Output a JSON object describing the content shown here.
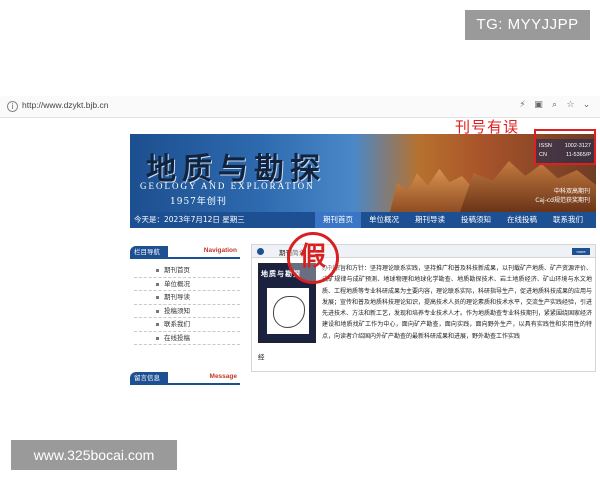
{
  "watermarks": {
    "top": "TG: MYYJJPP",
    "bottom": "www.325bocai.com"
  },
  "browser": {
    "url": "http://www.dzykt.bjb.cn",
    "icons": [
      "bolt-icon",
      "cube-icon",
      "zoom-icon",
      "star-icon",
      "chevron-down-icon"
    ]
  },
  "annotation": {
    "label": "刊号有误",
    "color": "#e02020"
  },
  "banner": {
    "title_cn": "地质与勘探",
    "title_en": "GEOLOGY AND EXPLORATION",
    "founded": "1957年创刊",
    "issn_label": "ISSN",
    "issn_value": "1002-3127",
    "cn_label": "CN",
    "cn_value": "11-5365/P",
    "core_line1": "中科双高期刊",
    "core_line2": "Caj-cd规范获奖期刊"
  },
  "navbar": {
    "date": "今天是：2023年7月12日 星期三",
    "items": [
      "期刊首页",
      "单位概况",
      "期刊导读",
      "投稿须知",
      "在线投稿",
      "联系我们"
    ],
    "active_index": 0
  },
  "sidebar": {
    "nav_title": "栏目导航",
    "nav_title_en": "Navigation",
    "items": [
      "期刊首页",
      "单位概况",
      "期刊导读",
      "投稿须知",
      "联系我们",
      "在线投稿"
    ],
    "message_title": "留言信息",
    "message_title_en": "Message"
  },
  "main": {
    "section_title": "期刊简介",
    "more_label": "more",
    "cover_title": "地质与勘探",
    "intro": "办刊宗旨和方针：坚持理论联系实践，坚持推广和普及科技新成果，以刊载矿产地质、矿产资源评价、成矿规律与成矿预测、地球物理和地球化学勘查、地质勘探技术、岩土地质经济、矿山环境与水文地质、工程地质等专业科研成果为主要内容，理论联系实际，科研指导生产，促进地质科技成果的应用与发展；宣传和普及地质科技理论知识，提高技术人员的理论素质和技术水平，交流生产实践经验，引进先进技术、方法和新工艺，发现和培养专业技术人才。作为地质勘查专业科技期刊，紧紧围绕国家经济建设和地质找矿工作为中心，面向矿产勘查，面向实践，面向野外生产，以具有实践性和实用性的特点，向读者介绍国内外矿产勘查的最新科研成果和进展，野外勘查工作实践",
    "intro_tail": "经",
    "stamp": "假"
  }
}
